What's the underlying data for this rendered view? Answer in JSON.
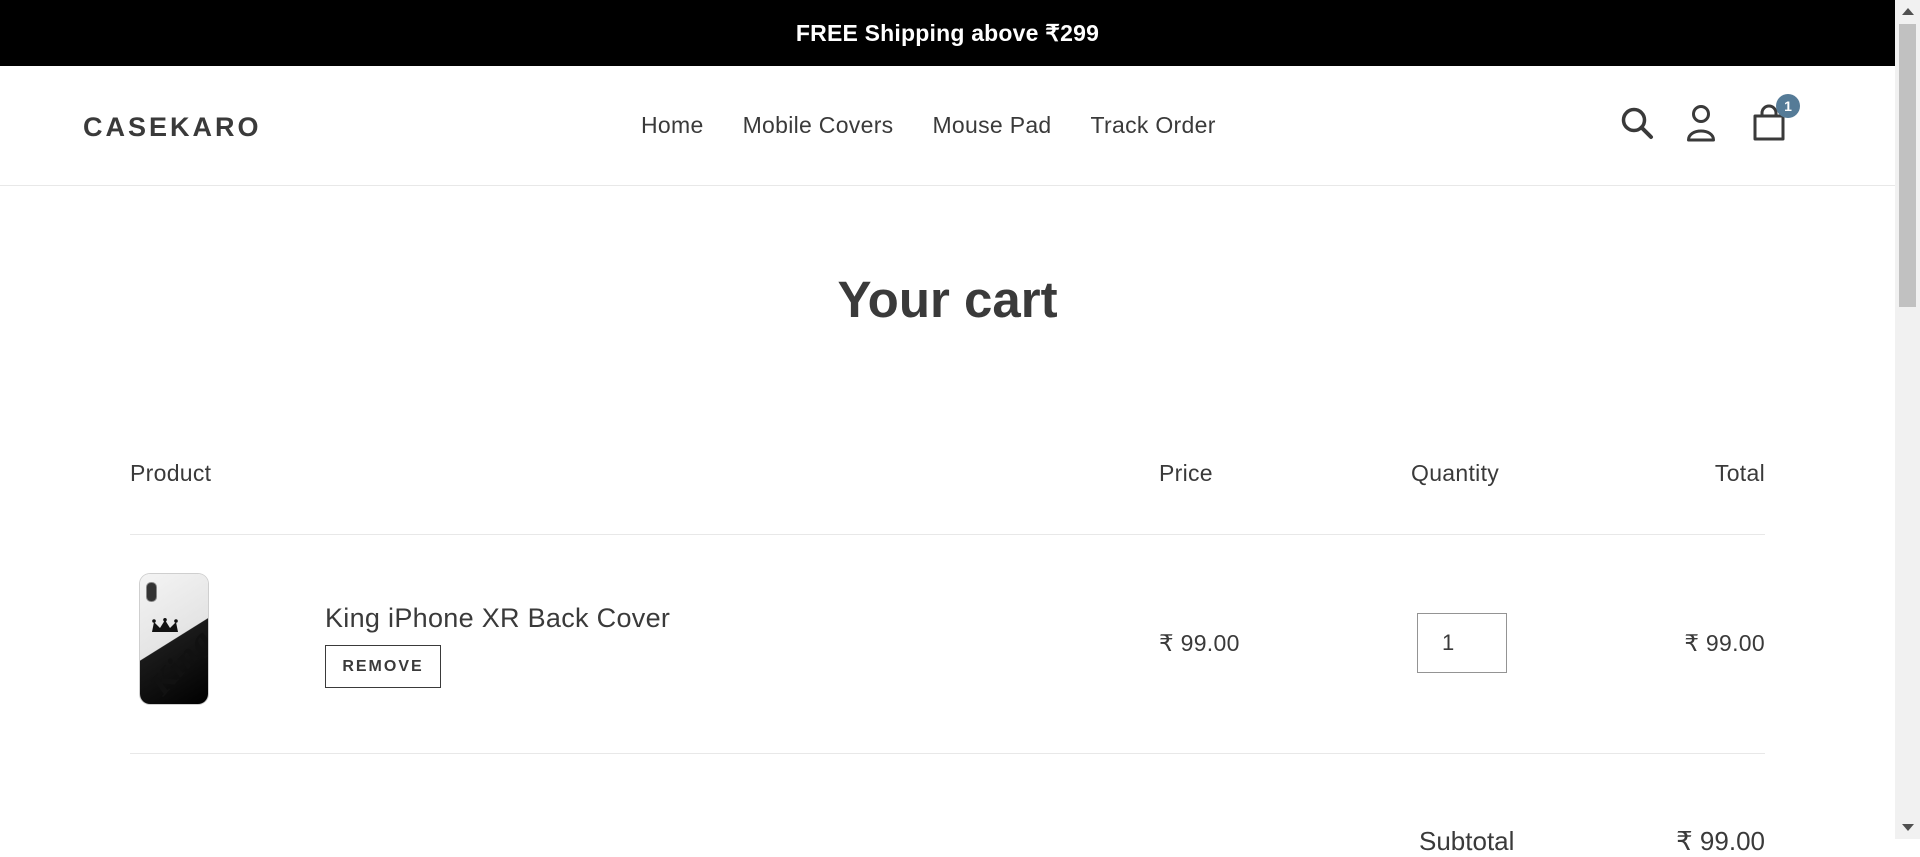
{
  "announcement": "FREE Shipping above ₹299",
  "header": {
    "logo": "CASEKARO",
    "nav": [
      "Home",
      "Mobile Covers",
      "Mouse Pad",
      "Track Order"
    ],
    "cart_count": "1"
  },
  "cart": {
    "title": "Your cart",
    "columns": {
      "product": "Product",
      "price": "Price",
      "quantity": "Quantity",
      "total": "Total"
    },
    "items": [
      {
        "name": "King iPhone XR Back Cover",
        "image_text": "King",
        "remove_label": "REMOVE",
        "price": "₹ 99.00",
        "quantity": "1",
        "total": "₹ 99.00"
      }
    ],
    "subtotal_label": "Subtotal",
    "subtotal_value": "₹ 99.00"
  },
  "icons": {
    "search": "search-icon",
    "account": "account-icon",
    "cart": "cart-icon"
  },
  "colors": {
    "announcement_bg": "#000000",
    "text": "#3a3a3a",
    "cart_badge": "#557b97"
  }
}
